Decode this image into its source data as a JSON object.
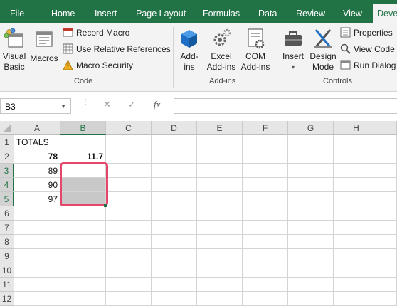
{
  "menu": {
    "tabs": [
      "File",
      "Home",
      "Insert",
      "Page Layout",
      "Formulas",
      "Data",
      "Review",
      "View"
    ],
    "active_tab": "Deve"
  },
  "ribbon": {
    "code": {
      "label": "Code",
      "visual_basic": [
        "Visual",
        "Basic"
      ],
      "macros": "Macros",
      "record_macro": "Record Macro",
      "relative_refs": "Use Relative References",
      "macro_security": "Macro Security"
    },
    "addins": {
      "label": "Add-ins",
      "addins": [
        "Add-",
        "ins"
      ],
      "excel_addins": [
        "Excel",
        "Add-ins"
      ],
      "com_addins": [
        "COM",
        "Add-ins"
      ]
    },
    "controls": {
      "label": "Controls",
      "insert": "Insert",
      "insert_caret": "▾",
      "design_mode": [
        "Design",
        "Mode"
      ],
      "properties": "Properties",
      "view_code": "View Code",
      "run_dialog": "Run Dialog"
    }
  },
  "formula_bar": {
    "name_box": "B3",
    "cancel_icon": "✕",
    "enter_icon": "✓",
    "fx": "fx",
    "value": ""
  },
  "sheet": {
    "columns": [
      "A",
      "B",
      "C",
      "D",
      "E",
      "F",
      "G",
      "H"
    ],
    "selected_column": "B",
    "rows": [
      "1",
      "2",
      "3",
      "4",
      "5",
      "6",
      "7",
      "8",
      "9",
      "10",
      "11",
      "12"
    ],
    "cells": {
      "A1": "TOTALS",
      "A2": "78",
      "B2": "11.7",
      "A3": "89",
      "A4": "90",
      "A5": "97"
    }
  },
  "colors": {
    "brand": "#217346",
    "highlight": "#e8456b",
    "selection": "#c8c8c8"
  }
}
